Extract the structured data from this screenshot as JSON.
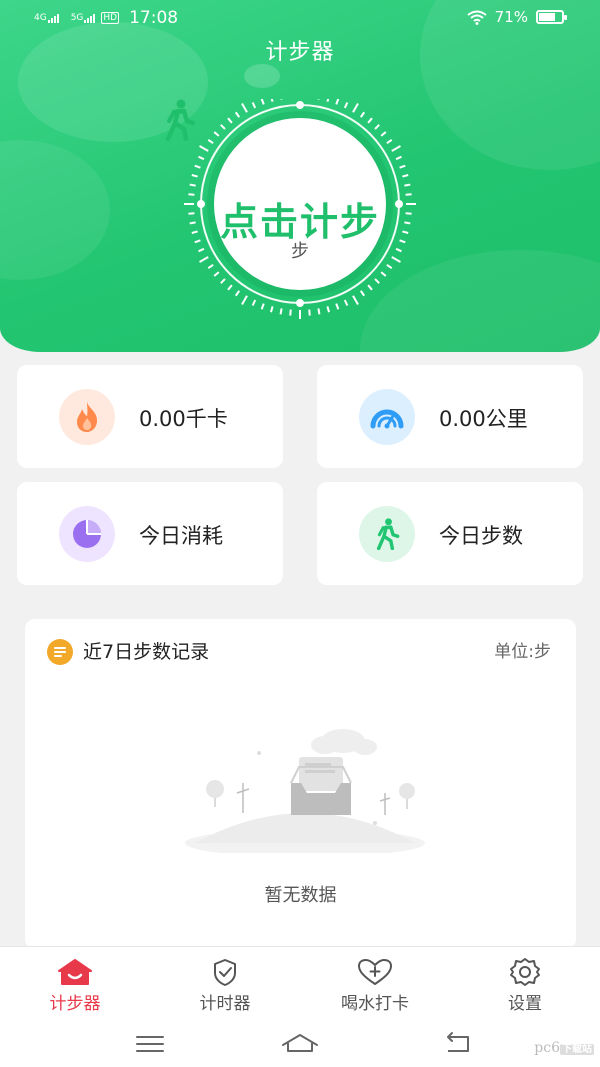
{
  "status_bar": {
    "signal_1": "4G",
    "signal_2": "5G",
    "hd": "HD",
    "time": "17:08",
    "battery": "71%",
    "battery_level": 0.71
  },
  "header": {
    "title": "计步器"
  },
  "counter": {
    "action_label": "点击计步",
    "unit": "步"
  },
  "stats": [
    {
      "label": "0.00千卡",
      "icon": "flame-icon",
      "color": "#ff8a4c"
    },
    {
      "label": "0.00公里",
      "icon": "speedometer-icon",
      "color": "#2f9cf5"
    },
    {
      "label": "今日消耗",
      "icon": "pie-chart-icon",
      "color": "#9a6ff0"
    },
    {
      "label": "今日步数",
      "icon": "walker-icon",
      "color": "#22c571"
    }
  ],
  "record": {
    "title": "近7日步数记录",
    "unit": "单位:步",
    "empty_text": "暂无数据"
  },
  "tabs": [
    {
      "label": "计步器",
      "icon": "home-icon",
      "active": true
    },
    {
      "label": "计时器",
      "icon": "check-circle-icon",
      "active": false
    },
    {
      "label": "喝水打卡",
      "icon": "heart-plus-icon",
      "active": false
    },
    {
      "label": "设置",
      "icon": "gear-icon",
      "active": false
    }
  ],
  "colors": {
    "brand_green": "#22c571",
    "tab_active_red": "#e8394a"
  },
  "watermark": {
    "text": "pc6",
    "badge": "下载站"
  }
}
